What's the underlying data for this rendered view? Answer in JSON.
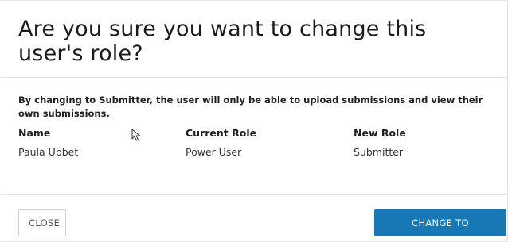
{
  "dialog": {
    "title": "Are you sure you want to change this user's role?",
    "message": "By changing to Submitter, the user will only be able to upload submissions and view their own submissions.",
    "table": {
      "headers": {
        "name": "Name",
        "current_role": "Current Role",
        "new_role": "New Role"
      },
      "row": {
        "name": "Paula Ubbet",
        "current_role": "Power User",
        "new_role": "Submitter"
      }
    },
    "buttons": {
      "close": "CLOSE",
      "confirm": "CHANGE TO SUBMITTER"
    }
  },
  "colors": {
    "primary": "#1778b5",
    "divider": "#e4e4e4"
  },
  "icons": {
    "cursor": "mouse-pointer-icon"
  }
}
